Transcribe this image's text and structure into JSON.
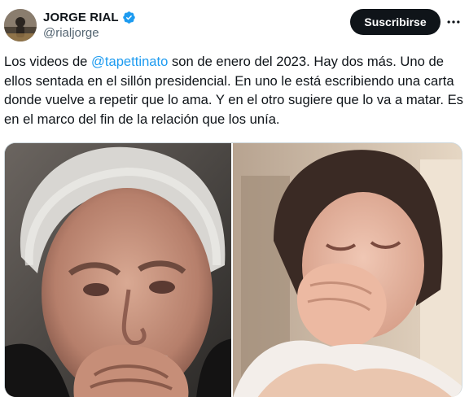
{
  "author": {
    "display_name": "JORGE RIAL",
    "handle": "@rialjorge",
    "verified": true,
    "avatar_icon": "user-avatar"
  },
  "actions": {
    "subscribe_label": "Suscribirse",
    "more_icon": "more-horizontal-icon"
  },
  "tweet": {
    "text_before_mention": "Los videos de ",
    "mention": "@tapettinato",
    "text_after_mention": " son de enero del 2023. Hay dos más. Uno de ellos sentada en el sillón presidencial. En uno le está escribiendo una carta donde vuelve a repetir que lo ama. Y en el otro sugiere que lo va a matar. Es en el marco del fin de la relación que los unía."
  },
  "media": {
    "left_photo": "photo-man-hands-clasped",
    "right_photo": "photo-woman-crying"
  },
  "colors": {
    "accent": "#1d9bf0",
    "text": "#0f1419",
    "secondary": "#536471",
    "button": "#0f1419"
  }
}
